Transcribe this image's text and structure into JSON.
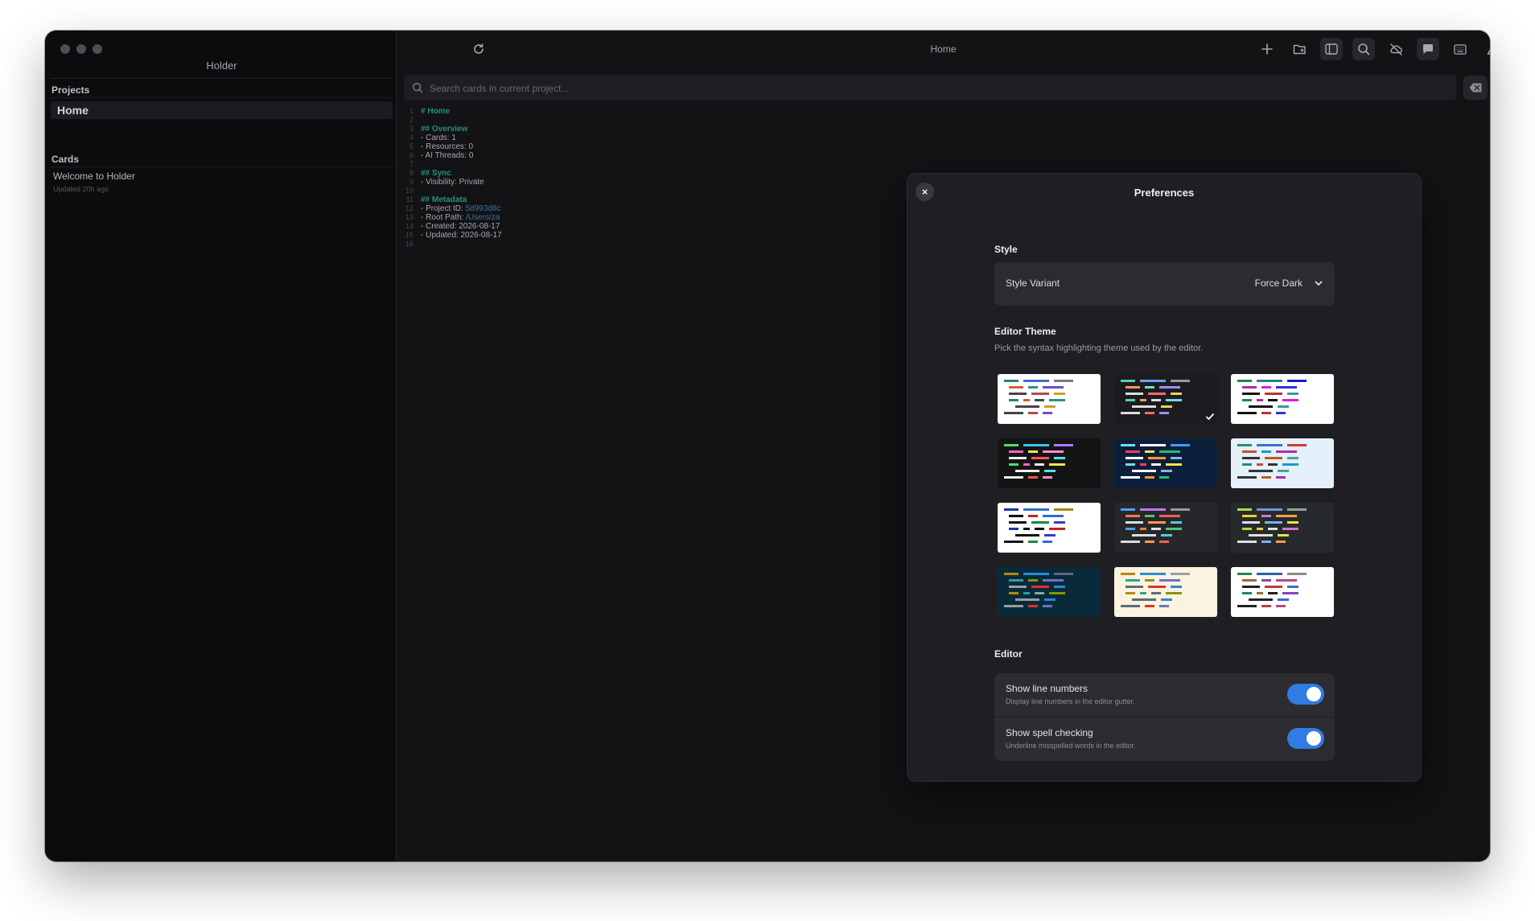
{
  "app": {
    "title": "Holder"
  },
  "sidebar": {
    "projects_label": "Projects",
    "projects": [
      {
        "label": "Home"
      }
    ],
    "cards_label": "Cards",
    "cards": [
      {
        "title": "Welcome to Holder",
        "subtitle": "Updated 20h ago"
      }
    ]
  },
  "topbar": {
    "title": "Home",
    "actions": [
      {
        "name": "add-button",
        "icon": "plus-icon"
      },
      {
        "name": "new-folder-button",
        "icon": "folder-plus-icon"
      },
      {
        "name": "toggle-sidebar-button",
        "icon": "sidebar-icon"
      },
      {
        "name": "search-button",
        "icon": "search-icon"
      },
      {
        "name": "sync-off-button",
        "icon": "cloud-off-icon"
      },
      {
        "name": "chat-button",
        "icon": "chat-bubble-icon"
      },
      {
        "name": "keyboard-button",
        "icon": "keyboard-icon"
      },
      {
        "name": "labs-button",
        "icon": "flask-icon"
      },
      {
        "name": "menu-button",
        "icon": "menu-icon"
      }
    ],
    "reload_icon": "reload-icon"
  },
  "search": {
    "placeholder": "Search cards in current project..."
  },
  "editor": {
    "lines": [
      {
        "n": "1",
        "text": "# Home",
        "heading": true
      },
      {
        "n": "2",
        "text": ""
      },
      {
        "n": "3",
        "text": "## Overview",
        "heading": true
      },
      {
        "n": "4",
        "text": "- Cards: 1"
      },
      {
        "n": "5",
        "text": "- Resources: 0"
      },
      {
        "n": "6",
        "text": "- AI Threads: 0"
      },
      {
        "n": "7",
        "text": ""
      },
      {
        "n": "8",
        "text": "## Sync",
        "heading": true
      },
      {
        "n": "9",
        "text": "- Visibility: Private"
      },
      {
        "n": "10",
        "text": ""
      },
      {
        "n": "11",
        "text": "## Metadata",
        "heading": true
      },
      {
        "n": "12",
        "text": "- Project ID: ",
        "value": "5d993d8c"
      },
      {
        "n": "13",
        "text": "- Root Path: ",
        "value": "/Users/za"
      },
      {
        "n": "14",
        "text": "- Created: 2026-08-17"
      },
      {
        "n": "15",
        "text": "- Updated: 2026-08-17"
      },
      {
        "n": "16",
        "text": ""
      }
    ]
  },
  "preferences": {
    "title": "Preferences",
    "close_label": "×",
    "style": {
      "section": "Style",
      "variant_label": "Style Variant",
      "variant_value": "Force Dark"
    },
    "editor_theme": {
      "section": "Editor Theme",
      "description": "Pick the syntax highlighting theme used by the editor.",
      "selected_index": 1,
      "themes": [
        {
          "bg": "#ffffff",
          "colors": [
            "#1f8a6d",
            "#3a6fd1",
            "#7a7a7a",
            "#d3602a",
            "#2c8f8f",
            "#6a4fc8",
            "#444444",
            "#b04a4a",
            "#c9a227"
          ]
        },
        {
          "bg": "#1c1c20",
          "colors": [
            "#5ad1a8",
            "#6fa0ff",
            "#9a9a9a",
            "#ff9a4a",
            "#6ee0d0",
            "#a48cff",
            "#dddddd",
            "#ff6a6a",
            "#f1d05a"
          ]
        },
        {
          "bg": "#ffffff",
          "colors": [
            "#198a4a",
            "#1a8a8a",
            "#1a1ad8",
            "#b02ab0",
            "#e01ae0",
            "#3030e0",
            "#111111",
            "#c03030",
            "#2aa0a0"
          ]
        },
        {
          "bg": "#141414",
          "colors": [
            "#4adf70",
            "#36c5f0",
            "#a87bff",
            "#ff62c8",
            "#f0e64a",
            "#ff8ad8",
            "#eeeeee",
            "#ff5555",
            "#57e0e0"
          ]
        },
        {
          "bg": "#0c1f3a",
          "colors": [
            "#6ae0ff",
            "#ffffff",
            "#3aa0ff",
            "#ff3a6a",
            "#f0e84a",
            "#22c06a",
            "#ffffff",
            "#ff9a2a",
            "#8ab0ff"
          ]
        },
        {
          "bg": "#e4f0fa",
          "colors": [
            "#2a8f6a",
            "#3a6fd1",
            "#d03a3a",
            "#c4502a",
            "#1a9ad0",
            "#b02ab0",
            "#333333",
            "#c05a20",
            "#4aa0a0"
          ]
        },
        {
          "bg": "#ffffff",
          "colors": [
            "#1a3aa0",
            "#2a6fd1",
            "#a08a1a",
            "#111111",
            "#c02020",
            "#2a6fd1",
            "#111111",
            "#1a8a3a",
            "#3a3ad0"
          ]
        },
        {
          "bg": "#25272b",
          "colors": [
            "#4aa0ff",
            "#c07af0",
            "#9a9a9a",
            "#ff7a3a",
            "#5ac07a",
            "#ff5a5a",
            "#dddddd",
            "#ff9a4a",
            "#4ad0d0"
          ]
        },
        {
          "bg": "#262a2c",
          "colors": [
            "#a8e04a",
            "#6a9ad8",
            "#9aa0a0",
            "#f0d02a",
            "#d07ad0",
            "#ffa04a",
            "#e0e0e0",
            "#7ab0ff",
            "#f0e04a"
          ]
        },
        {
          "bg": "#0a2a3a",
          "colors": [
            "#b5890a",
            "#268bd2",
            "#586e75",
            "#2aa198",
            "#859900",
            "#6c71c4",
            "#93a1a1",
            "#dc322f",
            "#268bd2"
          ]
        },
        {
          "bg": "#fbf3e0",
          "colors": [
            "#b5890a",
            "#268bd2",
            "#93a1a1",
            "#2aa198",
            "#859900",
            "#6c71c4",
            "#586e75",
            "#dc322f",
            "#268bd2"
          ]
        },
        {
          "bg": "#ffffff",
          "colors": [
            "#1a8a4a",
            "#2a5fb0",
            "#8a8a8a",
            "#a06a2a",
            "#7a4ab0",
            "#b04a8a",
            "#222222",
            "#c03a3a",
            "#3a6ad0"
          ]
        }
      ]
    },
    "editor": {
      "section": "Editor",
      "toggles": [
        {
          "label": "Show line numbers",
          "description": "Display line numbers in the editor gutter.",
          "on": true
        },
        {
          "label": "Show spell checking",
          "description": "Underline misspelled words in the editor.",
          "on": true
        }
      ]
    }
  }
}
